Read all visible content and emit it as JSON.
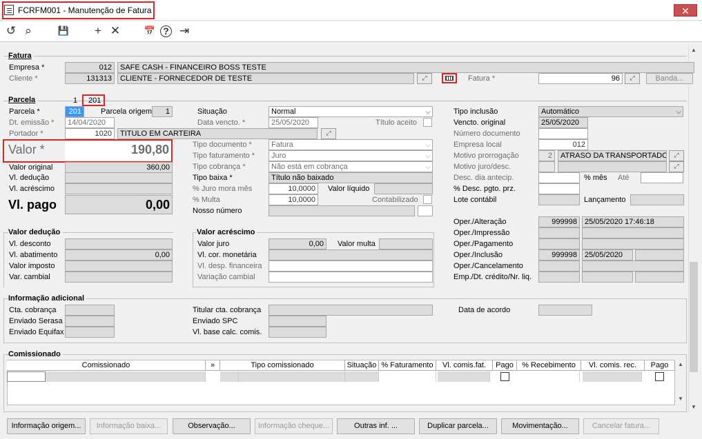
{
  "window": {
    "title": "FCRFM001 - Manutenção de Fatura",
    "close": "✕"
  },
  "toolbar": {
    "undo": "↺",
    "search": "⌕",
    "save": "💾",
    "add": "+",
    "cancel": "✕",
    "calendar": "📅",
    "help": "?",
    "exit": "⇥"
  },
  "fatura": {
    "group_label": "Fatura",
    "empresa_label": "Empresa *",
    "empresa_code": "012",
    "empresa_name": "SAFE CASH - FINANCEIRO BOSS TESTE",
    "cliente_label": "Cliente *",
    "cliente_code": "131313",
    "cliente_name": "CLIENTE - FORNECEDOR DE TESTE",
    "fatura_label": "Fatura *",
    "fatura_value": "96",
    "banda_label": "Banda..."
  },
  "parcela": {
    "group_label": "Parcela",
    "counter_1": "1",
    "counter_2": "201",
    "parcela_label": "Parcela *",
    "parcela_value": "201",
    "origem_label": "Parcela origem",
    "origem_value": "1",
    "emissao_label": "Dt. emissão *",
    "emissao_value": "14/04/2020",
    "portador_label": "Portador *",
    "portador_code": "1020",
    "portador_name": "TITULO EM CARTEIRA",
    "valor_label": "Valor *",
    "valor_value": "190,80",
    "valor_original_label": "Valor original",
    "valor_original_value": "360,00",
    "vl_deducao_label": "Vl. dedução",
    "vl_acrescimo_label": "Vl. acréscimo",
    "vl_pago_label": "Vl. pago",
    "vl_pago_value": "0,00",
    "situacao_label": "Situação",
    "situacao_value": "Normal",
    "vencto_label": "Data vencto. *",
    "vencto_value": "25/05/2020",
    "titulo_aceito_label": "Título aceito",
    "tipo_doc_label": "Tipo documento *",
    "tipo_doc_value": "Fatura",
    "tipo_fat_label": "Tipo faturamento *",
    "tipo_fat_value": "Juro",
    "tipo_cob_label": "Tipo cobrança *",
    "tipo_cob_value": "Não está em cobrança",
    "tipo_baixa_label": "Tipo baixa *",
    "tipo_baixa_value": "Título não baixado",
    "juro_mora_label": "% Juro mora mês",
    "juro_mora_value": "10,0000",
    "valor_liquido_label": "Valor líquido",
    "multa_label": "% Multa",
    "multa_value": "10,0000",
    "contabilizado_label": "Contabilizado",
    "nosso_numero_label": "Nosso número",
    "tipo_inclusao_label": "Tipo inclusão",
    "tipo_inclusao_value": "Automático",
    "vencto_original_label": "Vencto. original",
    "vencto_original_value": "25/05/2020",
    "numero_doc_label": "Número documento",
    "empresa_local_label": "Empresa local",
    "empresa_local_value": "012",
    "motivo_prorr_label": "Motivo prorrogação",
    "motivo_prorr_code": "2",
    "motivo_prorr_value": "ATRASO DA TRANSPORTADORA",
    "motivo_juro_label": "Motivo juro/desc.",
    "desc_antecip_label": "Desc. dia antecip.",
    "pct_mes_label": "% mês",
    "ate_label": "Até",
    "desc_pgto_label": "% Desc. pgto. prz.",
    "lote_contabil_label": "Lote contábil",
    "lancamento_label": "Lançamento"
  },
  "valor_deducao": {
    "group_label": "Valor dedução",
    "desconto_label": "Vl. desconto",
    "abatimento_label": "Vl. abatimento",
    "abatimento_value": "0,00",
    "imposto_label": "Valor imposto",
    "cambial_label": "Var. cambial"
  },
  "valor_acrescimo": {
    "group_label": "Valor acréscimo",
    "juro_label": "Valor juro",
    "juro_value": "0,00",
    "multa_label": "Valor multa",
    "monetaria_label": "Vl. cor. monetária",
    "financeira_label": "Vl. desp. financeira",
    "cambial_label": "Variação cambial"
  },
  "operacoes": {
    "alteracao_label": "Oper./Alteração",
    "alteracao_user": "999998",
    "alteracao_date": "25/05/2020 17:46:18",
    "impressao_label": "Oper./Impressão",
    "pagamento_label": "Oper./Pagamento",
    "inclusao_label": "Oper./Inclusão",
    "inclusao_user": "999998",
    "inclusao_date": "25/05/2020",
    "cancelamento_label": "Oper./Cancelamento",
    "emp_credito_label": "Emp./Dt. crédito/Nr. liq."
  },
  "info_adicional": {
    "group_label": "Informação adicional",
    "cta_cobranca_label": "Cta. cobrança",
    "serasa_label": "Enviado Serasa",
    "equifax_label": "Enviado Equifax",
    "titular_label": "Titular cta. cobrança",
    "spc_label": "Enviado SPC",
    "base_calc_label": "Vl. base calc. comis.",
    "data_acordo_label": "Data de acordo"
  },
  "comissionado": {
    "group_label": "Comissionado",
    "columns": [
      "Comissionado",
      "»",
      "Tipo comissionado",
      "Situação",
      "% Faturamento",
      "Vl. comis.fat.",
      "Pago",
      "% Recebimento",
      "Vl. comis. rec.",
      "Pago"
    ]
  },
  "buttons": {
    "info_origem": "Informação origem...",
    "info_baixa": "Informação baixa...",
    "observacao": "Observação...",
    "info_cheque": "Informação cheque...",
    "outras_inf": "Outras inf. ...",
    "duplicar": "Duplicar parcela...",
    "movimentacao": "Movimentação...",
    "cancelar": "Cancelar fatura..."
  }
}
